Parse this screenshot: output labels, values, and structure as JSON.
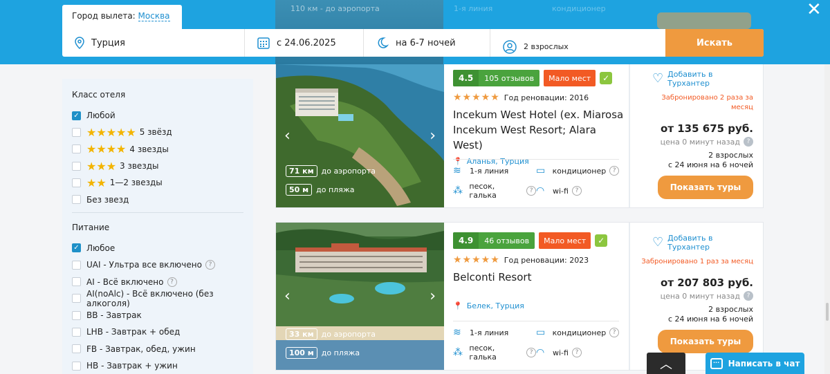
{
  "header": {
    "departure_label": "Город вылета:",
    "departure_city": "Москва",
    "destination": "Турция",
    "date": "с 24.06.2025",
    "nights": "на 6-7 ночей",
    "guests": "2 взрослых",
    "search_button": "Искать",
    "close_glyph": "✕",
    "ghost": {
      "airport": "110 км - до аэропорта",
      "line": "1-я линия",
      "ac": "кондиционер"
    }
  },
  "sidebar": {
    "hotel_class_title": "Класс отеля",
    "hotel_class": [
      {
        "label": "Любой",
        "checked": true,
        "stars": ""
      },
      {
        "label": "5 звёзд",
        "checked": false,
        "stars": "★★★★★"
      },
      {
        "label": "4 звезды",
        "checked": false,
        "stars": "★★★★"
      },
      {
        "label": "3 звезды",
        "checked": false,
        "stars": "★★★"
      },
      {
        "label": "1—2 звезды",
        "checked": false,
        "stars": "★★"
      },
      {
        "label": "Без звезд",
        "checked": false,
        "stars": ""
      }
    ],
    "meals_title": "Питание",
    "meals": [
      {
        "label": "Любое",
        "checked": true,
        "help": false
      },
      {
        "label": "UAI - Ультра все включено",
        "checked": false,
        "help": true
      },
      {
        "label": "AI - Всё включено",
        "checked": false,
        "help": true
      },
      {
        "label": "AI(noAlc) - Всё включено (без алкоголя)",
        "checked": false,
        "help": false
      },
      {
        "label": "BB - Завтрак",
        "checked": false,
        "help": false
      },
      {
        "label": "LHB - Завтрак + обед",
        "checked": false,
        "help": false
      },
      {
        "label": "FB - Завтрак, обед, ужин",
        "checked": false,
        "help": false
      },
      {
        "label": "HB - Завтрак + ужин",
        "checked": false,
        "help": false
      }
    ]
  },
  "hotels": [
    {
      "rating": "4.5",
      "reviews": "105 отзывов",
      "few_left": "Мало мест",
      "stars": "★★★★★",
      "renovation": "Год реновации: 2016",
      "name": "Incekum West Hotel (ex. Miarosa Incekum West Resort; Alara West)",
      "location": "Аланья, Турция",
      "airport_km": "71 км",
      "airport_label": "до аэропорта",
      "beach_m": "50 м",
      "beach_label": "до пляжа",
      "amenities": [
        "1-я линия",
        "кондиционер",
        "песок, галька",
        "wi-fi"
      ],
      "favorite": "Добавить в Турхантер",
      "booked": "Забронировано 2 раза за месяц",
      "price": "от 135 675 руб.",
      "updated": "цена 0 минут назад",
      "pax": "2 взрослых",
      "dates": "с 24 июня на 6 ночей",
      "button": "Показать туры"
    },
    {
      "rating": "4.9",
      "reviews": "46 отзывов",
      "few_left": "Мало мест",
      "stars": "★★★★★",
      "renovation": "Год реновации: 2023",
      "name": "Belconti Resort",
      "location": "Белек, Турция",
      "airport_km": "33 км",
      "airport_label": "до аэропорта",
      "beach_m": "100 м",
      "beach_label": "до пляжа",
      "amenities": [
        "1-я линия",
        "кондиционер",
        "песок, галька",
        "wi-fi"
      ],
      "favorite": "Добавить в Турхантер",
      "booked": "Забронировано 1 раз за месяц",
      "price": "от 207 803 руб.",
      "updated": "цена 0 минут назад",
      "pax": "2 взрослых",
      "dates": "с 24 июня на 6 ночей",
      "button": "Показать туры"
    }
  ],
  "floating": {
    "to_top_glyph": "︿",
    "chat": "Написать в чат"
  },
  "colors": {
    "brand_blue": "#1ea3e0",
    "accent_orange": "#ef9a3f",
    "rating_green": "#4aa33d",
    "alert_red": "#f25a24"
  }
}
